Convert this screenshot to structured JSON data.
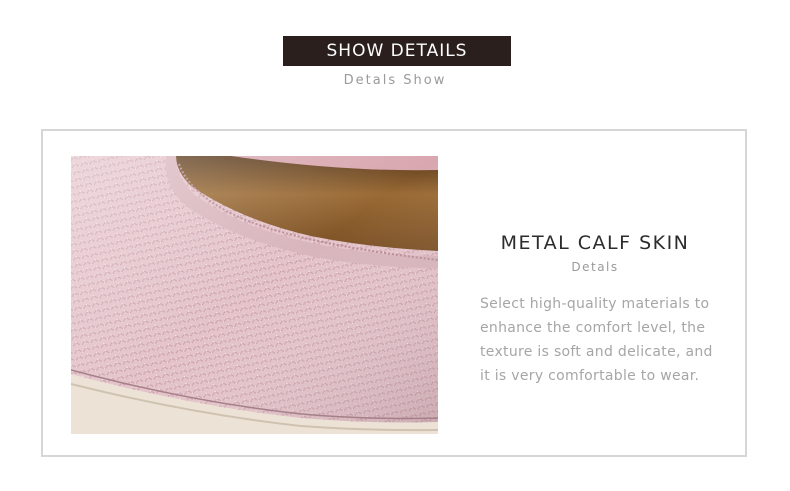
{
  "header": {
    "title": "SHOW DETAILS",
    "subtitle": "Detals Show"
  },
  "feature": {
    "title": "METAL CALF SKIN",
    "subtitle": "Detals",
    "description_lines": [
      "Select high-quality materials to",
      "enhance the comfort level, the",
      "texture is soft and delicate, and",
      "it is very comfortable to wear."
    ]
  },
  "colors": {
    "header_bg": "#2a1f1c",
    "leather_pink": "#e7c9cf",
    "insole_brown": "#8a5c2c",
    "sole_cream": "#ece3d6"
  }
}
